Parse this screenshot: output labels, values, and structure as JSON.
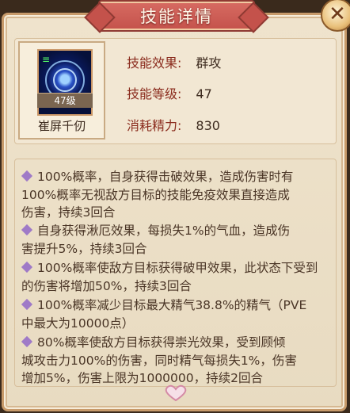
{
  "title": "技能详情",
  "close_icon": "close-icon",
  "skill": {
    "name": "崔屏千仞",
    "level_badge": "47级",
    "icon": "blue-vortex-skill-icon"
  },
  "stats": [
    {
      "label": "技能效果:",
      "value": "群攻"
    },
    {
      "label": "技能等级:",
      "value": "47"
    },
    {
      "label": "消耗精力:",
      "value": "830"
    }
  ],
  "descriptions": [
    {
      "lines": [
        "100%概率，自身获得击破效果，造成伤害时有",
        "100%概率无视敌方目标的技能免疫效果直接造成",
        "伤害，持续3回合"
      ]
    },
    {
      "lines": [
        "自身获得湫厄效果，每损失1%的气血，造成伤",
        "害提升5%，持续3回合"
      ]
    },
    {
      "lines": [
        "100%概率使敌方目标获得破甲效果，此状态下受到",
        "的伤害将增加50%，持续3回合"
      ]
    },
    {
      "lines": [
        "100%概率减少目标最大精气38.8%的精气（PVE",
        "中最大为10000点）"
      ]
    },
    {
      "lines": [
        "80%概率使敌方目标获得崇光效果，受到顾倾",
        "城攻击力100%的伤害，同时精气每损失1%，伤害",
        "增加5%，伤害上限为1000000，持续2回合"
      ]
    }
  ],
  "colors": {
    "accent": "#d85c10",
    "label": "#8b2c1e",
    "bullet": "#9f7ac7"
  }
}
